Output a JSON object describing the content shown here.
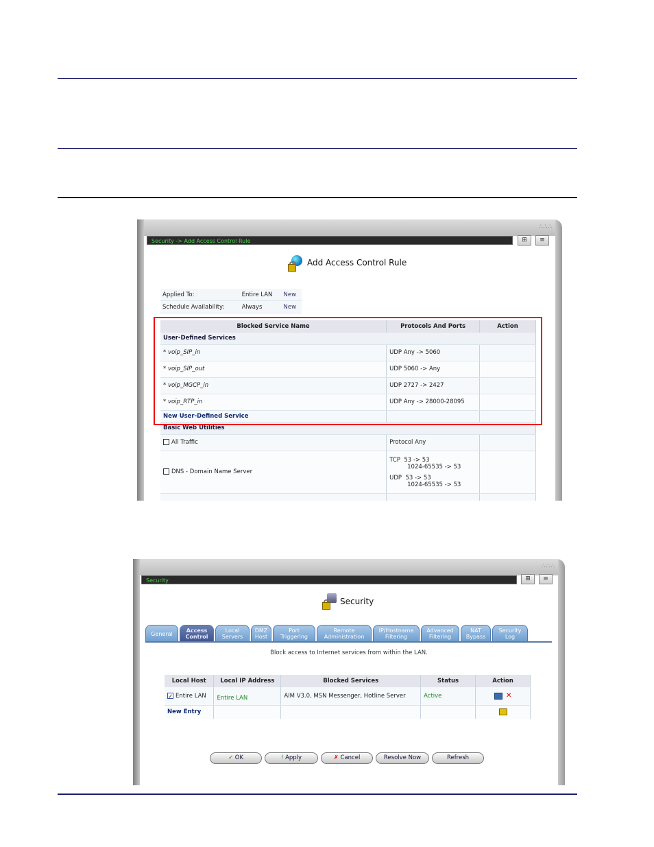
{
  "window1": {
    "address": "Security -> Add Access Control Rule",
    "title": "Add Access Control Rule",
    "applied": [
      {
        "label": "Applied To:",
        "value": "Entire LAN",
        "link": "New"
      },
      {
        "label": "Schedule Availability:",
        "value": "Always",
        "link": "New"
      }
    ],
    "columns": [
      "Blocked Service Name",
      "Protocols And Ports",
      "Action"
    ],
    "user_defined_header": "User-Defined Services",
    "user_defined": [
      {
        "name": "* voip_SIP_in",
        "proto": "UDP  Any -> 5060"
      },
      {
        "name": "* voip_SIP_out",
        "proto": "UDP  5060 -> Any"
      },
      {
        "name": "* voip_MGCP_in",
        "proto": "UDP  2727 -> 2427"
      },
      {
        "name": "* voip_RTP_in",
        "proto": "UDP  Any -> 28000-28095"
      }
    ],
    "new_service": "New User-Defined Service",
    "basic_header": "Basic Web Utilities",
    "all_traffic": {
      "name": "All Traffic",
      "proto": "Protocol Any"
    },
    "dns": {
      "name": "DNS - Domain Name Server",
      "tcp_label": "TCP",
      "tcp_1": "53 -> 53",
      "tcp_2": "1024-65535 -> 53",
      "udp_label": "UDP",
      "udp_1": "53 -> 53",
      "udp_2": "1024-65535 -> 53"
    }
  },
  "window2": {
    "address": "Security",
    "title": "Security",
    "tabs": [
      {
        "l1": "General",
        "l2": ""
      },
      {
        "l1": "Access",
        "l2": "Control"
      },
      {
        "l1": "Local",
        "l2": "Servers"
      },
      {
        "l1": "DMZ",
        "l2": "Host"
      },
      {
        "l1": "Port",
        "l2": "Triggering"
      },
      {
        "l1": "Remote",
        "l2": "Administration"
      },
      {
        "l1": "IP/Hostname",
        "l2": "Filtering"
      },
      {
        "l1": "Advanced",
        "l2": "Filtering"
      },
      {
        "l1": "NAT",
        "l2": "Bypass"
      },
      {
        "l1": "Security",
        "l2": "Log"
      }
    ],
    "message": "Block access to Internet services from within the LAN.",
    "columns": [
      "Local Host",
      "Local IP Address",
      "Blocked Services",
      "Status",
      "Action"
    ],
    "row": {
      "host": "Entire LAN",
      "ip": "Entire LAN",
      "services": "AIM V3.0, MSN Messenger, Hotline Server",
      "status": "Active"
    },
    "new_entry": "New Entry",
    "buttons": {
      "ok": "OK",
      "apply": "Apply",
      "cancel": "Cancel",
      "resolve": "Resolve Now",
      "refresh": "Refresh"
    },
    "colors": {
      "status_active": "#1a8a1a",
      "tab_active": "#3f5590",
      "tab": "#6e9fcf"
    }
  }
}
